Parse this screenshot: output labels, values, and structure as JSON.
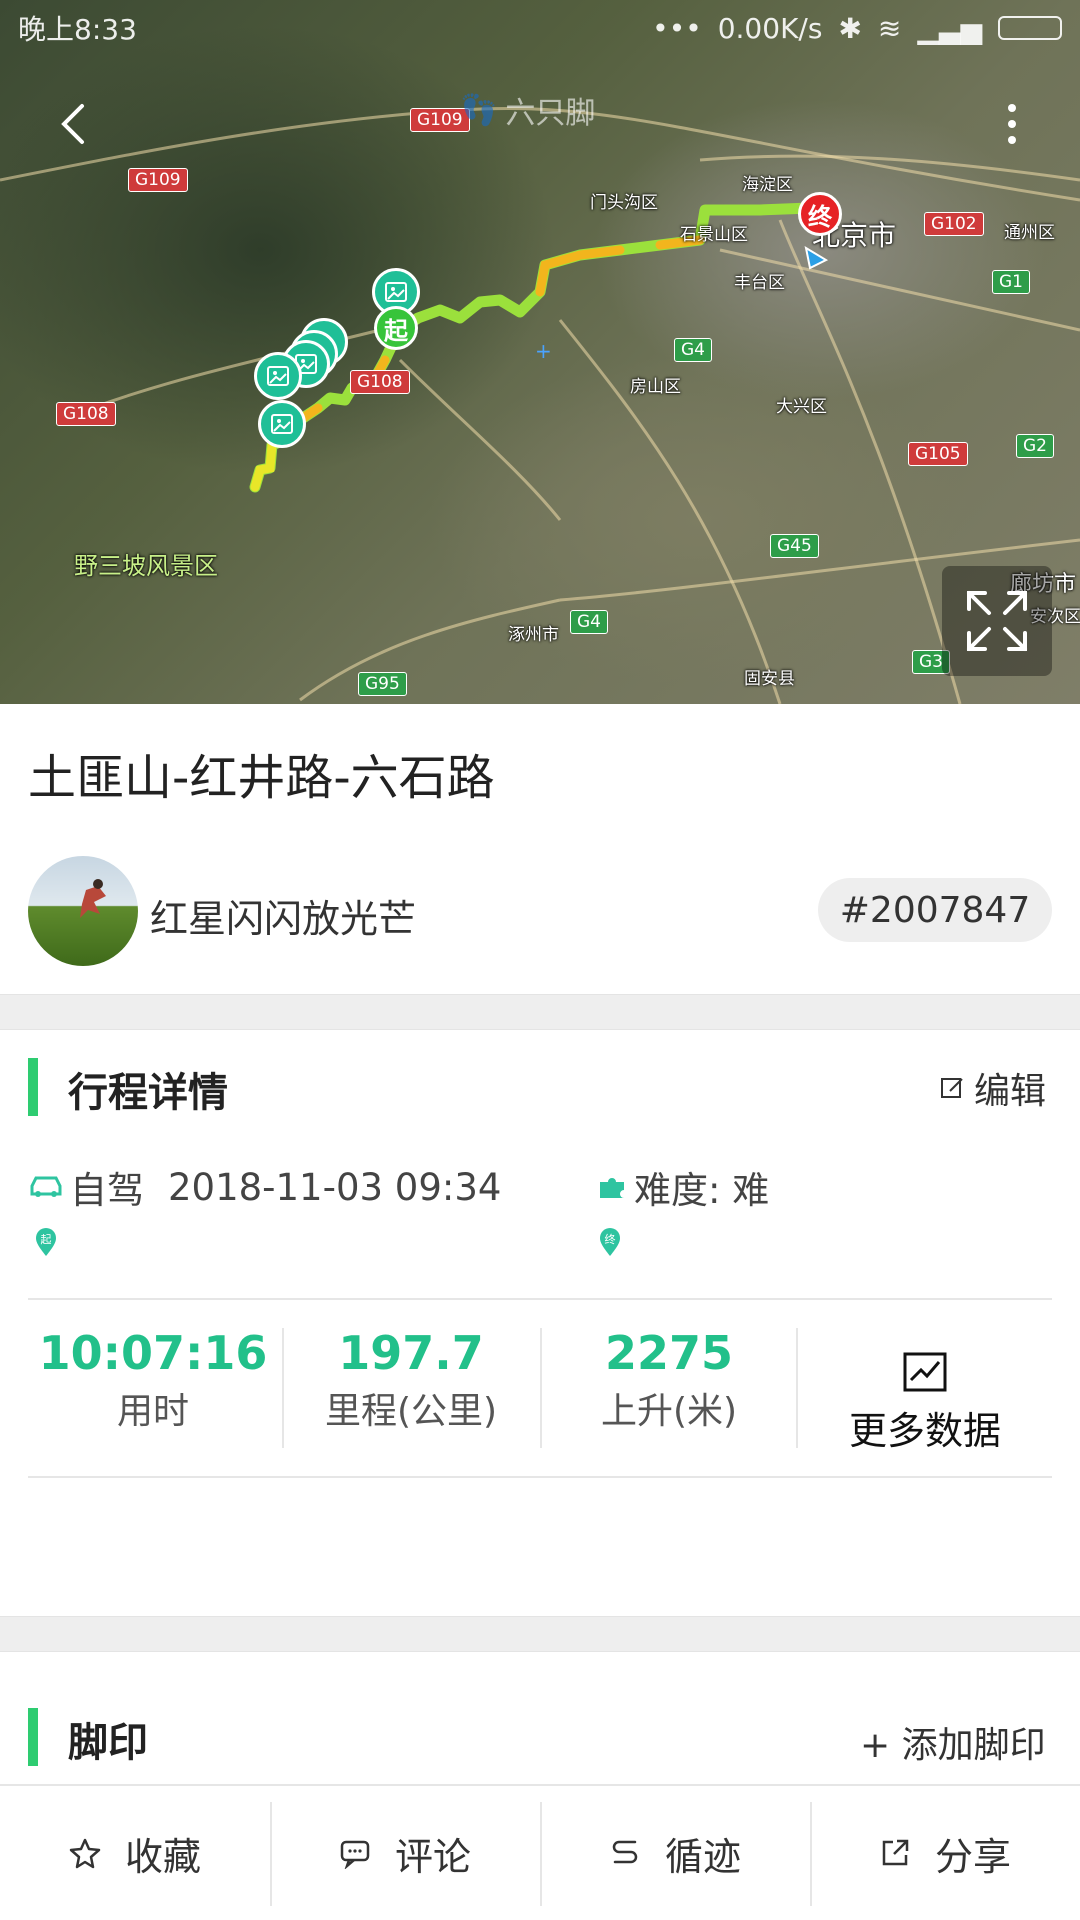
{
  "status_bar": {
    "time": "晚上8:33",
    "network_speed": "0.00K/s"
  },
  "map": {
    "watermark": "六只脚",
    "places": {
      "haidian": "海淀区",
      "mentougou": "门头沟区",
      "shijingshan": "石景山区",
      "beijing": "北京市",
      "fengtai": "丰台区",
      "tongzhou": "通州区",
      "fangshan": "房山区",
      "daxing": "大兴区",
      "yesanpo": "野三坡风景区",
      "zhuozhou": "涿州市",
      "guan": "固安县",
      "langfang": "廊坊市",
      "anci": "安次区"
    },
    "roads": {
      "g109a": "G109",
      "g109b": "G109",
      "g108a": "G108",
      "g108b": "G108",
      "g102": "G102",
      "g1": "G1",
      "g4a": "G4",
      "g4b": "G4",
      "g105": "G105",
      "g2": "G2",
      "g45": "G45",
      "g95": "G95",
      "g3": "G3"
    },
    "start_label": "起",
    "end_label": "终"
  },
  "track": {
    "title": "土匪山-红井路-六石路",
    "author": "红星闪闪放光芒",
    "id": "#2007847"
  },
  "details": {
    "section_title": "行程详情",
    "edit_label": "编辑",
    "mode": "自驾",
    "datetime": "2018-11-03  09:34",
    "difficulty": "难度: 难",
    "start_marker": "起",
    "end_marker": "终"
  },
  "stats": {
    "duration": {
      "value": "10:07:16",
      "label": "用时"
    },
    "distance": {
      "value": "197.7",
      "label": "里程(公里)"
    },
    "ascent": {
      "value": "2275",
      "label": "上升(米)"
    },
    "more_label": "更多数据"
  },
  "footprints": {
    "section_title": "脚印",
    "add_label": "+ 添加脚印"
  },
  "bottom_bar": {
    "favorite": "收藏",
    "comment": "评论",
    "follow_track": "循迹",
    "share": "分享"
  },
  "colors": {
    "accent_green": "#22c08a",
    "section_bar": "#2ecc71",
    "end_red": "#e62225"
  }
}
